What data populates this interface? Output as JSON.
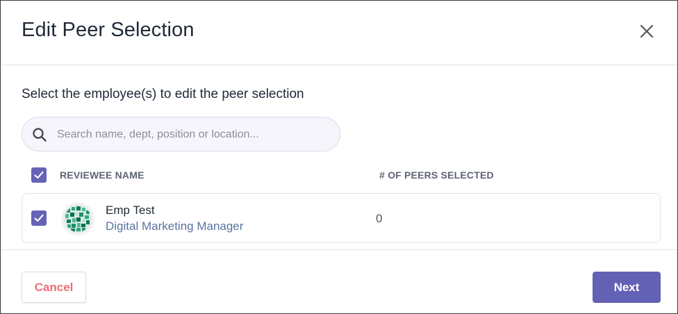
{
  "modal": {
    "title": "Edit Peer Selection",
    "close_icon": "close-icon"
  },
  "instruction": "Select the employee(s) to edit the peer selection",
  "search": {
    "placeholder": "Search name, dept, position or location...",
    "value": "",
    "icon": "search-icon"
  },
  "table": {
    "select_all_checked": true,
    "columns": [
      "REVIEWEE NAME",
      "# OF PEERS SELECTED"
    ],
    "rows": [
      {
        "checked": true,
        "name": "Emp Test",
        "position": "Digital Marketing Manager",
        "peers_selected": "0"
      }
    ]
  },
  "footer": {
    "cancel_label": "Cancel",
    "next_label": "Next"
  },
  "colors": {
    "accent": "#6361b3",
    "cancel_text": "#ea7176",
    "position_text": "#5b73a0"
  }
}
